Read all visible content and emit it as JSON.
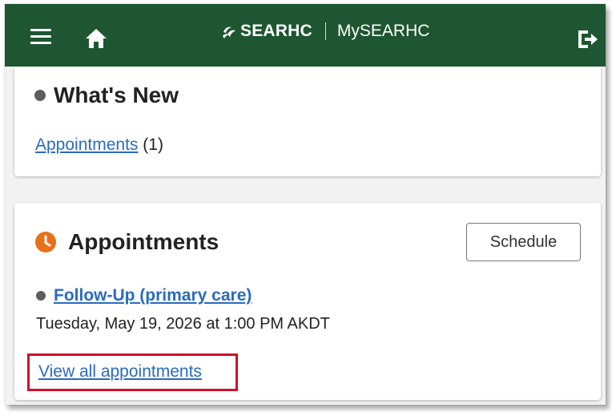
{
  "header": {
    "brand_name": "SEARHC",
    "app_name": "MySEARHC",
    "colors": {
      "background": "#1e5631",
      "text": "#ffffff"
    },
    "icons": [
      "menu-icon",
      "home-icon",
      "leaf-logo-icon",
      "logout-icon"
    ]
  },
  "whats_new": {
    "title": "What's New",
    "link_label": "Appointments",
    "count": "(1)"
  },
  "appointments": {
    "title": "Appointments",
    "icon": "clock-icon",
    "icon_color": "#e8701a",
    "schedule_label": "Schedule",
    "items": [
      {
        "label": "Follow-Up (primary care)",
        "datetime": "Tuesday, May 19, 2026 at 1:00 PM AKDT"
      }
    ],
    "view_all_label": "View all appointments",
    "highlight_color": "#d0102a"
  },
  "colors": {
    "link": "#2a6bbf",
    "bullet": "#5c5c5c",
    "page_background": "#f2f2f2"
  }
}
